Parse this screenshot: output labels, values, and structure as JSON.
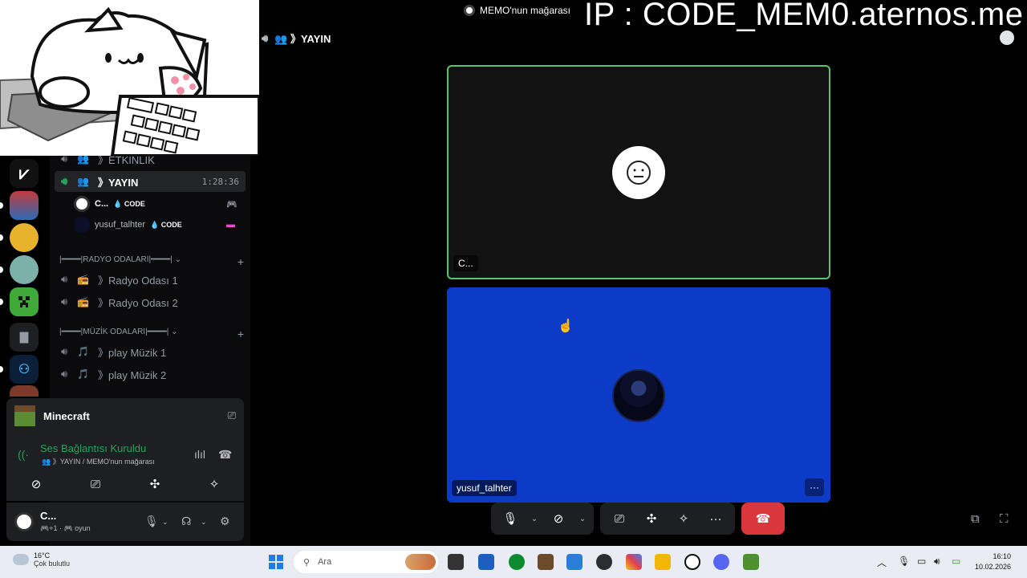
{
  "window": {
    "title": "MEMO'nun mağarası",
    "back": "←",
    "forward": "→"
  },
  "overlay": {
    "ip_text": "IP : CODE_MEM0.aternos.me"
  },
  "sidebar": {
    "channels": [
      {
        "emoji": "👥",
        "name": "》ETKİNLİK"
      },
      {
        "emoji": "👥",
        "name": "》YAYIN",
        "time": "1:28:36",
        "active": true
      },
      {
        "emoji": "📻",
        "name": "》Radyo Odası 1"
      },
      {
        "emoji": "📻",
        "name": "》Radyo Odası 2"
      },
      {
        "emoji": "🎵",
        "name": "》play Müzik 1"
      },
      {
        "emoji": "🎵",
        "name": "》play Müzik 2"
      }
    ],
    "voice_users": [
      {
        "name": "C...",
        "tag": "💧 CODE"
      },
      {
        "name": "yusuf_talhter",
        "tag": "💧 CODE"
      }
    ],
    "categories": [
      {
        "label": "|━━━━|RADYO ODALARI|━━━━| ⌄"
      },
      {
        "label": "|━━━━|MÜZİK ODALARI|━━━━| ⌄"
      }
    ]
  },
  "activity": {
    "name": "Minecraft"
  },
  "voice": {
    "status": "Ses Bağlantısı Kuruldu",
    "channel": "👥 》YAYIN / MEMO'nun mağarası"
  },
  "user_panel": {
    "name": "C...",
    "status": "🎮+1 · 🎮 oyun"
  },
  "stage": {
    "channel_name": "👥 》YAYIN",
    "tiles": [
      {
        "name": "C..."
      },
      {
        "name": "yusuf_talhter"
      }
    ],
    "more": "···"
  },
  "taskbar": {
    "temperature": "16°C",
    "weather": "Çok bulutlu",
    "search_placeholder": "Ara",
    "time": "16:10",
    "date": "10.02.2026"
  },
  "colors": {
    "speaking_border": "#57c26f",
    "tile_blue": "#0c3bc7",
    "leave_red": "#da373c",
    "connected_green": "#23a55a"
  }
}
